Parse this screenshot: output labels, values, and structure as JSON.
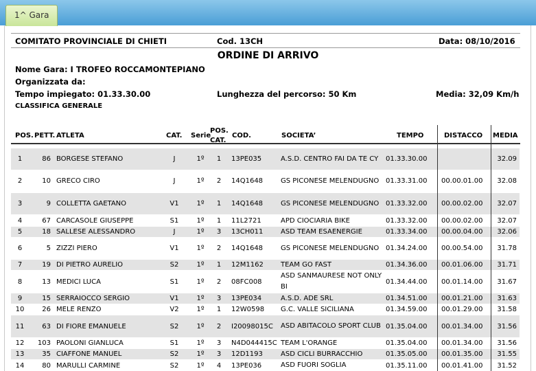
{
  "tab": {
    "label": "1^ Gara"
  },
  "header": {
    "committee": "COMITATO PROVINCIALE DI CHIETI",
    "code": "Cod. 13CH",
    "date": "Data: 08/10/2016",
    "title": "ORDINE DI ARRIVO",
    "race_name": "Nome Gara: I TROFEO ROCCAMONTEPIANO",
    "organized_by": "Organizzata da:",
    "time": "Tempo impiegato: 01.33.30.00",
    "length": "Lunghezza del percorso: 50 Km",
    "average": "Media: 32,09 Km/h",
    "classification": "CLASSIFICA GENERALE"
  },
  "columns": {
    "pos": "POS.",
    "pett": "PETT.",
    "atleta": "ATLETA",
    "cat": "CAT.",
    "serie": "Serie",
    "poscat": "POS. CAT.",
    "cod": "COD.",
    "societa": "SOCIETA’",
    "tempo": "TEMPO",
    "distacco": "DISTACCO",
    "media": "MEDIA"
  },
  "rows": [
    {
      "pos": "1",
      "pett": "86",
      "atleta": "BORGESE STEFANO",
      "cat": "J",
      "serie": "1º",
      "poscat": "1",
      "cod": "13PE035",
      "societa": "A.S.D. CENTRO FAI DA TE CY",
      "tempo": "01.33.30.00",
      "distacco": "",
      "media": "32.09"
    },
    {
      "pos": "2",
      "pett": "10",
      "atleta": "GRECO CIRO",
      "cat": "J",
      "serie": "1º",
      "poscat": "2",
      "cod": "14Q1648",
      "societa": "GS PICONESE MELENDUGNO",
      "tempo": "01.33.31.00",
      "distacco": "00.00.01.00",
      "media": "32.08"
    },
    {
      "pos": "3",
      "pett": "9",
      "atleta": "COLLETTA GAETANO",
      "cat": "V1",
      "serie": "1º",
      "poscat": "1",
      "cod": "14Q1648",
      "societa": "GS PICONESE MELENDUGNO",
      "tempo": "01.33.32.00",
      "distacco": "00.00.02.00",
      "media": "32.07"
    },
    {
      "pos": "4",
      "pett": "67",
      "atleta": "CARCASOLE GIUSEPPE",
      "cat": "S1",
      "serie": "1º",
      "poscat": "1",
      "cod": "11L2721",
      "societa": "APD CIOCIARIA BIKE",
      "tempo": "01.33.32.00",
      "distacco": "00.00.02.00",
      "media": "32.07"
    },
    {
      "pos": "5",
      "pett": "18",
      "atleta": "SALLESE ALESSANDRO",
      "cat": "J",
      "serie": "1º",
      "poscat": "3",
      "cod": "13CH011",
      "societa": "ASD TEAM ESAENERGIE",
      "tempo": "01.33.34.00",
      "distacco": "00.00.04.00",
      "media": "32.06"
    },
    {
      "pos": "6",
      "pett": "5",
      "atleta": "ZIZZI PIERO",
      "cat": "V1",
      "serie": "1º",
      "poscat": "2",
      "cod": "14Q1648",
      "societa": "GS PICONESE MELENDUGNO",
      "tempo": "01.34.24.00",
      "distacco": "00.00.54.00",
      "media": "31.78"
    },
    {
      "pos": "7",
      "pett": "19",
      "atleta": "DI PIETRO AURELIO",
      "cat": "S2",
      "serie": "1º",
      "poscat": "1",
      "cod": "12M1162",
      "societa": "TEAM GO FAST",
      "tempo": "01.34.36.00",
      "distacco": "00.01.06.00",
      "media": "31.71"
    },
    {
      "pos": "8",
      "pett": "13",
      "atleta": "MEDICI LUCA",
      "cat": "S1",
      "serie": "1º",
      "poscat": "2",
      "cod": "08FC008",
      "societa": "ASD SANMAURESE NOT ONLY BI",
      "tempo": "01.34.44.00",
      "distacco": "00.01.14.00",
      "media": "31.67"
    },
    {
      "pos": "9",
      "pett": "15",
      "atleta": "SERRAIOCCO SERGIO",
      "cat": "V1",
      "serie": "1º",
      "poscat": "3",
      "cod": "13PE034",
      "societa": "A.S.D. ADE SRL",
      "tempo": "01.34.51.00",
      "distacco": "00.01.21.00",
      "media": "31.63"
    },
    {
      "pos": "10",
      "pett": "26",
      "atleta": "MELE RENZO",
      "cat": "V2",
      "serie": "1º",
      "poscat": "1",
      "cod": "12W0598",
      "societa": "G.C. VALLE SICILIANA",
      "tempo": "01.34.59.00",
      "distacco": "00.01.29.00",
      "media": "31.58"
    },
    {
      "pos": "11",
      "pett": "63",
      "atleta": "DI FIORE EMANUELE",
      "cat": "S2",
      "serie": "1º",
      "poscat": "2",
      "cod": "I20098015C",
      "societa": "ASD ABITACOLO SPORT CLUB",
      "tempo": "01.35.04.00",
      "distacco": "00.01.34.00",
      "media": "31.56"
    },
    {
      "pos": "12",
      "pett": "103",
      "atleta": "PAOLONI GIANLUCA",
      "cat": "S1",
      "serie": "1º",
      "poscat": "3",
      "cod": "N4D044415C",
      "societa": "TEAM L'ORANGE",
      "tempo": "01.35.04.00",
      "distacco": "00.01.34.00",
      "media": "31.56"
    },
    {
      "pos": "13",
      "pett": "35",
      "atleta": "CIAFFONE MANUEL",
      "cat": "S2",
      "serie": "1º",
      "poscat": "3",
      "cod": "12D1193",
      "societa": "ASD CICLI BURRACCHIO",
      "tempo": "01.35.05.00",
      "distacco": "00.01.35.00",
      "media": "31.55"
    },
    {
      "pos": "14",
      "pett": "80",
      "atleta": "MARULLI CARMINE",
      "cat": "S2",
      "serie": "1º",
      "poscat": "4",
      "cod": "13PE036",
      "societa": "ASD FUORI SOGLIA",
      "tempo": "01.35.11.00",
      "distacco": "00.01.41.00",
      "media": "31.52"
    }
  ]
}
